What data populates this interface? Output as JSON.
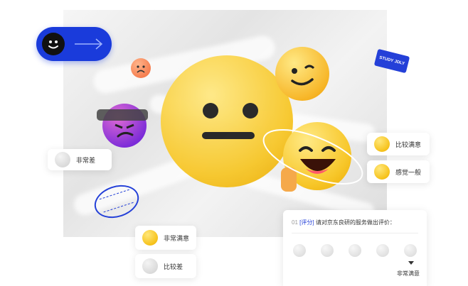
{
  "floating_cards": [
    {
      "label": "非常差"
    },
    {
      "label": "比较满意"
    },
    {
      "label": "感觉一般"
    },
    {
      "label": "非常满意"
    },
    {
      "label": "比较差"
    }
  ],
  "survey": {
    "number": "01",
    "tag": "[评分]",
    "question": "请对京东良研的服务做出评价：",
    "selected_label": "非常满意"
  },
  "sticker": {
    "badge_text": "STUDY JDLY"
  }
}
